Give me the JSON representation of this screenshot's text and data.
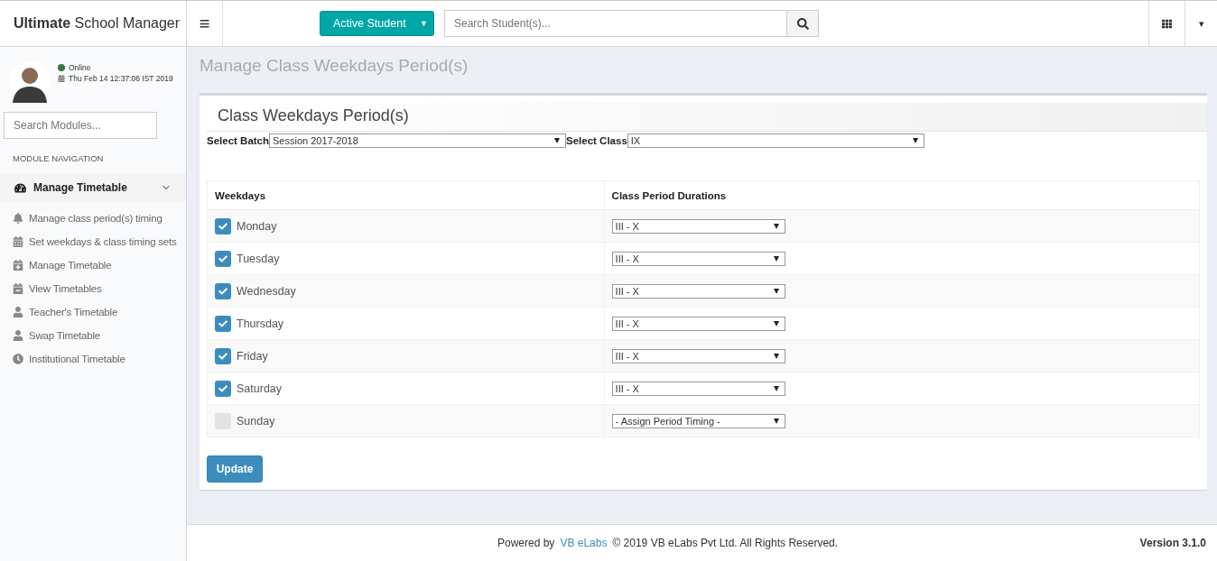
{
  "header": {
    "brand": "**Ultimate** School Manager",
    "menu_toggle": "≡",
    "student_dropdown": {
      "label": "Active Student",
      "caret": "▼"
    },
    "search": {
      "placeholder": "Search Student(s)..."
    },
    "user_caret": "▾"
  },
  "sidebar": {
    "user": {
      "status": "Online",
      "datetime": "Thu Feb 14 12:37:06 IST 2019"
    },
    "search": {
      "placeholder": "Search Modules..."
    },
    "section_title": "MODULE NAVIGATION",
    "menu": {
      "label": "Manage Timetable",
      "expanded": true,
      "children": [
        {
          "label": "Manage class period(s) timing"
        },
        {
          "label": "Set weekdays & class timing sets"
        },
        {
          "label": "Manage Timetable"
        },
        {
          "label": "View Timetables"
        },
        {
          "label": "Teacher's Timetable"
        },
        {
          "label": "Swap Timetable"
        },
        {
          "label": "Institutional Timetable"
        }
      ]
    }
  },
  "page_title": "Manage Class Weekdays Period(s)",
  "panel": {
    "title": "Class Weekdays Period(s)",
    "filters": [
      {
        "label": "Select Batch",
        "value": "Session 2017-2018"
      },
      {
        "label": "Select Class",
        "value": "IX"
      }
    ],
    "table": {
      "columns": [
        "Weekdays",
        "Class Period Durations"
      ],
      "rows": [
        {
          "day": "Monday",
          "checked": true,
          "duration": "III - X"
        },
        {
          "day": "Tuesday",
          "checked": true,
          "duration": "III - X"
        },
        {
          "day": "Wednesday",
          "checked": true,
          "duration": "III - X"
        },
        {
          "day": "Thursday",
          "checked": true,
          "duration": "III - X"
        },
        {
          "day": "Friday",
          "checked": true,
          "duration": "III - X"
        },
        {
          "day": "Saturday",
          "checked": true,
          "duration": "III - X"
        },
        {
          "day": "Sunday",
          "checked": false,
          "duration": "- Assign Period Timing -"
        }
      ]
    },
    "button": "Update"
  },
  "footer": {
    "powered_by": "Powered by",
    "link": "VB eLabs",
    "copyright": "© 2019 VB eLabs Pvt Ltd. All Rights Reserved.",
    "version": "Version 3.1.0"
  }
}
